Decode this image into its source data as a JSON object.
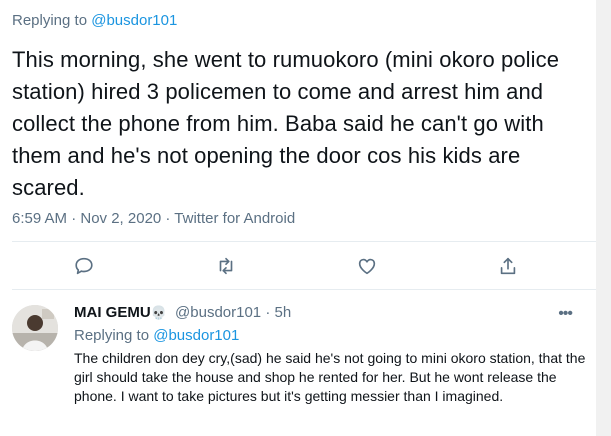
{
  "main_tweet": {
    "replying_prefix": "Replying to",
    "replying_handle": "@busdor101",
    "text": "This morning, she went to rumuokoro (mini okoro police station) hired 3 policemen to come and arrest him and collect the phone from him. Baba said he can't go with them and he's not opening the door cos his kids are scared.",
    "timestamp": "6:59 AM · Nov 2, 2020 · Twitter for Android"
  },
  "actions": [
    {
      "icon": "reply-icon"
    },
    {
      "icon": "retweet-icon"
    },
    {
      "icon": "like-icon"
    },
    {
      "icon": "share-icon"
    }
  ],
  "reply": {
    "display_name": "MAI GEMU",
    "name_emoji": "💀",
    "handle": "@busdor101",
    "separator": "·",
    "time_ago": "5h",
    "more_icon": "more-icon",
    "replying_prefix": "Replying to",
    "replying_handle": "@busdor101",
    "text": "The children don dey cry,(sad) he said he's not going to mini okoro station, that the girl should take the house and shop he rented for her. But he wont release the phone. I want to take pictures but it's getting messier than I imagined."
  },
  "colors": {
    "link": "#1b95e0",
    "muted": "#5b7083",
    "text": "#0f1419",
    "divider": "#e6ecf0"
  }
}
